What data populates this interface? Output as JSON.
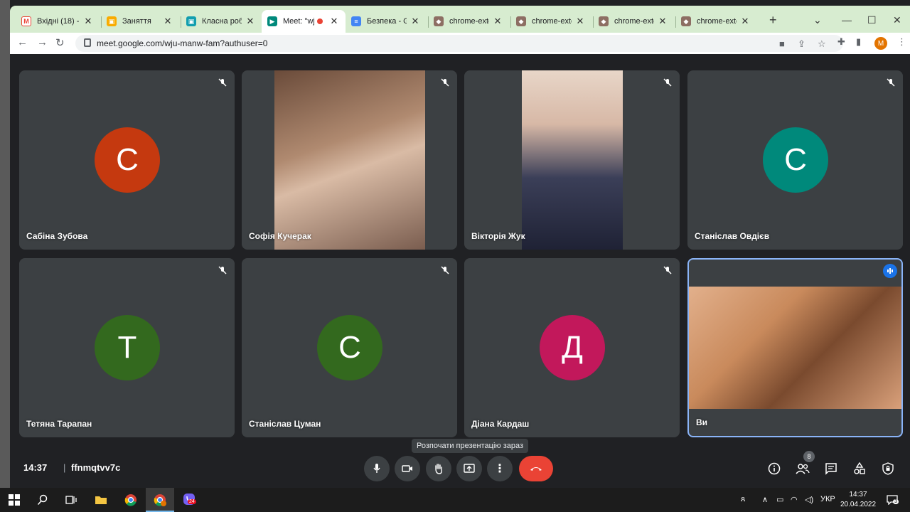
{
  "browser": {
    "tabs": [
      {
        "label": "Вхідні (18) - n",
        "icon": "gmail-icon",
        "color": "#ea4335",
        "active": false
      },
      {
        "label": "Заняття",
        "icon": "classroom-icon",
        "color": "#f9ab00",
        "active": false
      },
      {
        "label": "Класна робот",
        "icon": "classroom-assignment-icon",
        "color": "#129eaf",
        "active": false
      },
      {
        "label": "Meet: \"wj",
        "icon": "meet-icon",
        "color": "#00897b",
        "active": true
      },
      {
        "label": "Безпека - Go",
        "icon": "docs-icon",
        "color": "#4285f4",
        "active": false
      },
      {
        "label": "chrome-exten",
        "icon": "extension-owl-icon",
        "color": "#8d6e63",
        "active": false
      },
      {
        "label": "chrome-exten",
        "icon": "extension-owl-icon",
        "color": "#8d6e63",
        "active": false
      },
      {
        "label": "chrome-exten",
        "icon": "extension-owl-icon",
        "color": "#8d6e63",
        "active": false
      },
      {
        "label": "chrome-exten",
        "icon": "extension-owl-icon",
        "color": "#8d6e63",
        "active": false
      }
    ],
    "url": "meet.google.com/wju-manw-fam?authuser=0",
    "profile_initial": "M"
  },
  "meet": {
    "participants": [
      {
        "name": "Сабіна Зубова",
        "initial": "С",
        "avatar_color": "#c5390f",
        "muted": true,
        "video": false
      },
      {
        "name": "Софія Кучерак",
        "initial": "",
        "avatar_color": "",
        "muted": true,
        "video": true
      },
      {
        "name": "Вікторія Жук",
        "initial": "",
        "avatar_color": "",
        "muted": true,
        "video": true
      },
      {
        "name": "Станіслав Овдієв",
        "initial": "С",
        "avatar_color": "#00897b",
        "muted": true,
        "video": false
      },
      {
        "name": "Тетяна Тарапан",
        "initial": "Т",
        "avatar_color": "#33691e",
        "muted": true,
        "video": false
      },
      {
        "name": "Станіслав Цуман",
        "initial": "С",
        "avatar_color": "#33691e",
        "muted": true,
        "video": false
      },
      {
        "name": "Діана Кардаш",
        "initial": "Д",
        "avatar_color": "#c2185b",
        "muted": true,
        "video": false
      },
      {
        "name": "Ви",
        "initial": "",
        "avatar_color": "",
        "muted": false,
        "video": true,
        "speaking": true
      }
    ],
    "tooltip": "Розпочати презентацію зараз",
    "time": "14:37",
    "meeting_code": "ffnmqtvv7c",
    "participant_count": "8"
  },
  "taskbar": {
    "language": "УКР",
    "time": "14:37",
    "date": "20.04.2022",
    "notification_count": "3",
    "viber_badge": "24"
  },
  "colors": {
    "meet_bg": "#202124",
    "tile_bg": "#3c4043",
    "end_call": "#ea4335",
    "active_speaker": "#8ab4f8"
  }
}
